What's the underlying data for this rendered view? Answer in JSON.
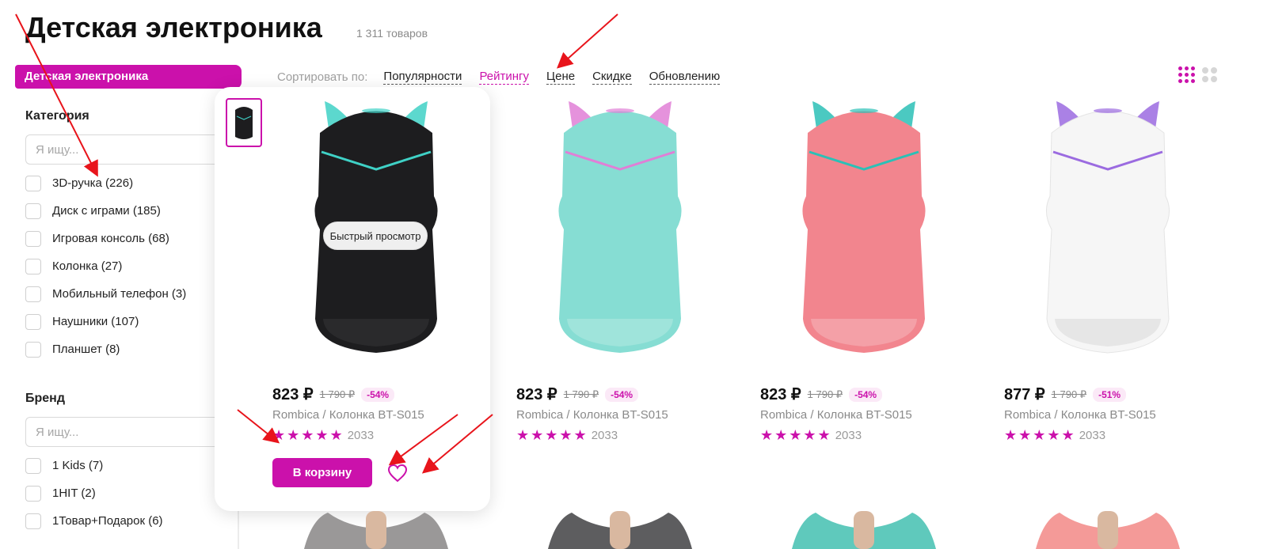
{
  "page": {
    "title": "Детская электроника",
    "count": "1 311 товаров"
  },
  "sidebar": {
    "active_category": "Детская электроника",
    "category_filter": {
      "title": "Категория",
      "search_placeholder": "Я ищу...",
      "items": [
        "3D-ручка (226)",
        "Диск с играми (185)",
        "Игровая консоль (68)",
        "Колонка (27)",
        "Мобильный телефон (3)",
        "Наушники (107)",
        "Планшет (8)"
      ]
    },
    "brand_filter": {
      "title": "Бренд",
      "search_placeholder": "Я ищу...",
      "items": [
        "1 Kids (7)",
        "1HIT (2)",
        "1Товар+Подарок (6)"
      ]
    }
  },
  "sort": {
    "label": "Сортировать по:",
    "options": [
      "Популярности",
      "Рейтингу",
      "Цене",
      "Скидке",
      "Обновлению"
    ],
    "active": "Рейтингу"
  },
  "view_icons": [
    "small-grid-icon",
    "large-grid-icon"
  ],
  "products": [
    {
      "price": "823 ₽",
      "old_price": "1 790 ₽",
      "discount": "-54%",
      "name": "Rombica / Колонка BT-S015",
      "stars": "★★★★★",
      "rating": 5,
      "reviews": "2033",
      "body_color": "#1d1d1f",
      "accent_color": "#3fd1c6",
      "grill_color": "#2a2a2c"
    },
    {
      "price": "823 ₽",
      "old_price": "1 790 ₽",
      "discount": "-54%",
      "name": "Rombica / Колонка BT-S015",
      "stars": "★★★★★",
      "rating": 5,
      "reviews": "2033",
      "body_color": "#86ddd3",
      "accent_color": "#e07fd6",
      "grill_color": "#9fe4db"
    },
    {
      "price": "823 ₽",
      "old_price": "1 790 ₽",
      "discount": "-54%",
      "name": "Rombica / Колонка BT-S015",
      "stars": "★★★★★",
      "rating": 5,
      "reviews": "2033",
      "body_color": "#f2858e",
      "accent_color": "#2bc0b6",
      "grill_color": "#f4a0a7"
    },
    {
      "price": "877 ₽",
      "old_price": "1 790 ₽",
      "discount": "-51%",
      "name": "Rombica / Колонка BT-S015",
      "stars": "★★★★★",
      "rating": 5,
      "reviews": "2033",
      "body_color": "#f6f6f6",
      "accent_color": "#9b6be0",
      "grill_color": "#e6e6e6"
    }
  ],
  "hover_card": {
    "quick_view": "Быстрый просмотр",
    "cart_button": "В корзину",
    "favorite_icon": "heart-icon"
  },
  "bottom_row_colors": [
    "#9a9898",
    "#5d5d5f",
    "#5fc9bc",
    "#f49a98"
  ],
  "colors": {
    "accent": "#cb11ab",
    "annotation": "#e8141b"
  }
}
